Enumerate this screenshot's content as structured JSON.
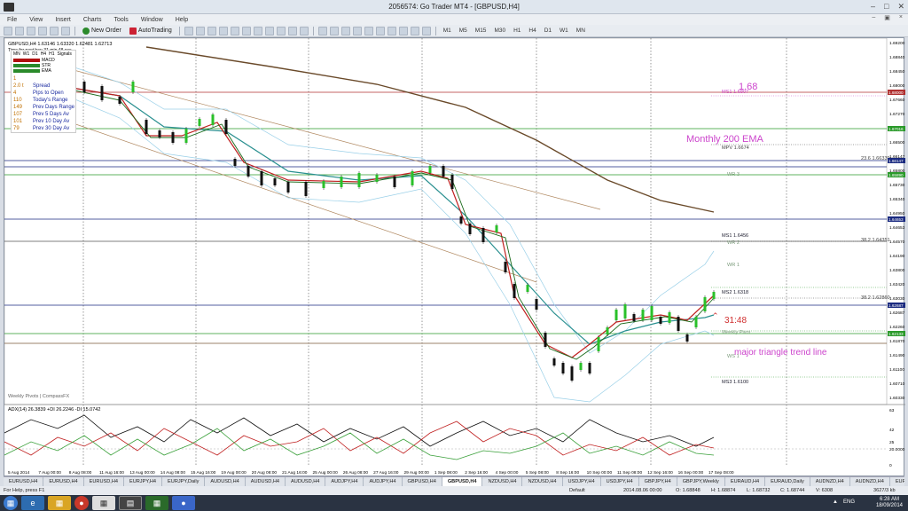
{
  "window": {
    "title": "2056574: Go Trader MT4 - [GBPUSD,H4]"
  },
  "menu": [
    "File",
    "View",
    "Insert",
    "Charts",
    "Tools",
    "Window",
    "Help"
  ],
  "toolbar": {
    "new_order": "New Order",
    "autotrading": "AutoTrading",
    "timeframes": [
      "M1",
      "M5",
      "M15",
      "M30",
      "H1",
      "H4",
      "D1",
      "W1",
      "MN"
    ]
  },
  "chart": {
    "header": "GBPUSD,H4 1.63146 1.63320 1.62481 1.62713",
    "timer": "Time for next bar: 31 min 48 sec",
    "legend_tfs": [
      "MN",
      "W1",
      "D1",
      "H4",
      "H1",
      "Signals"
    ],
    "legend_rows": [
      {
        "k": "MACD",
        "color": "#b01010"
      },
      {
        "k": "STR",
        "color": "#2a8a2a"
      },
      {
        "k": "EMA",
        "color": "#2a8a2a"
      }
    ],
    "info_rows": [
      {
        "v": "1",
        "label": ""
      },
      {
        "v": "2.0 t",
        "label": "Spread"
      },
      {
        "v": "4",
        "label": "Pips to Open"
      },
      {
        "v": "110",
        "label": "Today's Range"
      },
      {
        "v": "149",
        "label": "Prev Days Range"
      },
      {
        "v": "107",
        "label": "Prev 5 Days Av"
      },
      {
        "v": "101",
        "label": "Prev 10 Day Av"
      },
      {
        "v": "79",
        "label": "Prev 30 Day Av"
      }
    ],
    "watermark": "Weekly Pivots | CompassFX",
    "annotations": {
      "a168": "1.68",
      "monthly": "Monthly 200 EMA",
      "countdown": "31:48",
      "triangle": "major triangle trend line"
    },
    "level_labels": [
      {
        "t": "MS1 1.6807",
        "c": "#cc44cc"
      },
      {
        "t": "MPV 1.6674",
        "c": "#444"
      },
      {
        "t": "23.6 1.66339",
        "c": "#444"
      },
      {
        "t": "WR 3",
        "c": "#7a9a7a"
      },
      {
        "t": "MS1 1.6456",
        "c": "#223"
      },
      {
        "t": "WR 2",
        "c": "#7a9a7a"
      },
      {
        "t": "38.2 1.64351",
        "c": "#444"
      },
      {
        "t": "WR 1",
        "c": "#7a9a7a"
      },
      {
        "t": "MS2 1.6318",
        "c": "#223"
      },
      {
        "t": "38.2 1.62860",
        "c": "#444"
      },
      {
        "t": "Weekly Pivot",
        "c": "#7a9a7a"
      },
      {
        "t": "WS 1",
        "c": "#7a9a7a"
      },
      {
        "t": "MS3 1.6100",
        "c": "#223"
      }
    ],
    "price_ticks": [
      "1.69200",
      "1.68840",
      "1.68450",
      "1.68000",
      "1.67660",
      "1.67270",
      "1.66890",
      "1.66500",
      "1.66147",
      "1.65800",
      "1.65730",
      "1.65340",
      "1.64950",
      "1.64653",
      "1.64570",
      "1.64190",
      "1.63800",
      "1.63420",
      "1.63030",
      "1.62687",
      "1.62260",
      "1.61870",
      "1.61490",
      "1.61100",
      "1.60710",
      "1.60330"
    ],
    "highlight_prices": [
      {
        "t": "1.68000",
        "bg": "#b03030"
      },
      {
        "t": "1.67016",
        "bg": "#2a9a2a"
      },
      {
        "t": "1.66147",
        "bg": "#1a2a80"
      },
      {
        "t": "1.65890",
        "bg": "#2a9a2a"
      },
      {
        "t": "1.64653",
        "bg": "#1a2a80"
      },
      {
        "t": "1.62687",
        "bg": "#1a2a80"
      },
      {
        "t": "1.62133",
        "bg": "#2a9a2a"
      }
    ],
    "time_ticks": [
      "5 Aug 2014",
      "7 Aug 00:00",
      "8 Aug 08:00",
      "11 Aug 16:00",
      "13 Aug 00:00",
      "14 Aug 08:00",
      "15 Aug 16:00",
      "19 Aug 00:00",
      "20 Aug 08:00",
      "21 Aug 16:00",
      "25 Aug 00:00",
      "26 Aug 08:00",
      "27 Aug 16:00",
      "29 Aug 00:00",
      "1 Sep 08:00",
      "2 Sep 16:00",
      "4 Sep 00:00",
      "5 Sep 08:00",
      "8 Sep 16:00",
      "10 Sep 00:00",
      "11 Sep 08:00",
      "12 Sep 16:00",
      "16 Sep 00:00",
      "17 Sep 08:00"
    ],
    "adx_header": "ADX(14) 26.3839 +DI 26.2246 -DI 15.0742",
    "adx_ticks": [
      "63",
      "42",
      "25",
      "20.0000",
      "0"
    ]
  },
  "tabs": [
    "EURUSD,H4",
    "EURUSD,H4",
    "EURUSD,H4",
    "EURJPY,H4",
    "EURJPY,Daily",
    "AUDUSD,H4",
    "AUDUSD,H4",
    "AUDUSD,H4",
    "AUDJPY,H4",
    "AUDJPY,H4",
    "GBPUSD,H4",
    "GBPUSD,H4",
    "NZDUSD,H4",
    "NZDUSD,H4",
    "USDJPY,H4",
    "USDJPY,H4",
    "GBPJPY,H4",
    "GBPJPY,Weekly",
    "EURAUD,H4",
    "EURAUD,Daily",
    "AUDNZD,H4",
    "AUDNZD,H4",
    "EURNZD,H4",
    "GBPAUD,H4",
    "GBP"
  ],
  "active_tab": 11,
  "status": {
    "help": "For Help, press F1",
    "profile": "Default",
    "time": "2014.08.06 00:00",
    "o": "O: 1.68848",
    "h": "H: 1.68874",
    "l": "L: 1.68732",
    "c": "C: 1.68744",
    "v": "V: 6308",
    "kb": "3627/3 kb"
  },
  "taskbar": {
    "lang": "ENG",
    "time": "6:28 AM",
    "date": "18/09/2014"
  }
}
